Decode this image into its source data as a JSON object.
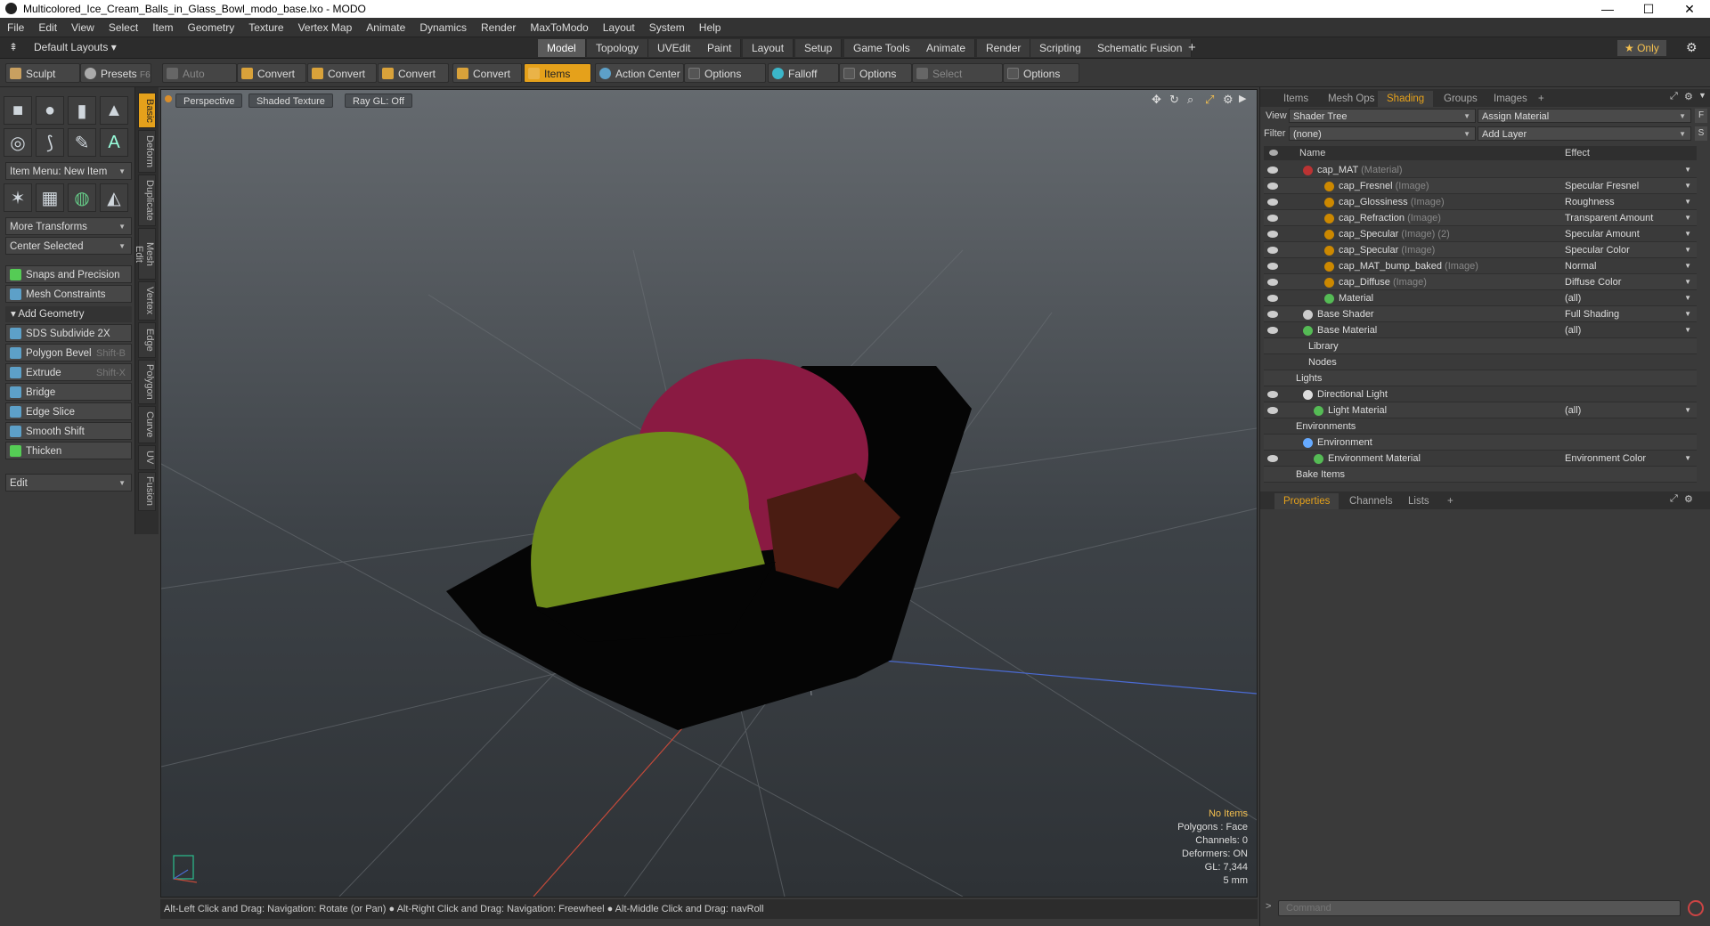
{
  "window": {
    "title": "Multicolored_Ice_Cream_Balls_in_Glass_Bowl_modo_base.lxo - MODO",
    "minimize": "—",
    "maximize": "☐",
    "close": "✕"
  },
  "menu": [
    "File",
    "Edit",
    "View",
    "Select",
    "Item",
    "Geometry",
    "Texture",
    "Vertex Map",
    "Animate",
    "Dynamics",
    "Render",
    "MaxToModo",
    "Layout",
    "System",
    "Help"
  ],
  "layout_bar": {
    "layouts": "Default Layouts ▾",
    "tabs": [
      "Model",
      "Topology",
      "UVEdit",
      "Paint",
      "Layout",
      "Setup",
      "Game Tools",
      "Animate",
      "Render",
      "Scripting",
      "Schematic Fusion"
    ],
    "active_tab": "Model",
    "add": "+",
    "only": "★ Only"
  },
  "toolbar": {
    "sculpt": "Sculpt",
    "presets": "Presets",
    "presets_key": "F6",
    "auto_select": "Auto Select",
    "convert1": "Convert",
    "convert2": "Convert",
    "convert3": "Convert",
    "convert4": "Convert",
    "items": "Items",
    "action_center": "Action Center",
    "options1": "Options",
    "falloff": "Falloff",
    "options2": "Options",
    "select_through": "Select Through",
    "options3": "Options"
  },
  "left_panel": {
    "item_menu": "Item Menu: New Item",
    "more_transforms": "More Transforms",
    "center_selected": "Center Selected",
    "snaps": "Snaps and Precision",
    "mesh_constraints": "Mesh Constraints",
    "add_geometry": "Add Geometry",
    "tools": [
      {
        "label": "SDS Subdivide 2X",
        "key": ""
      },
      {
        "label": "Polygon Bevel",
        "key": "Shift-B"
      },
      {
        "label": "Extrude",
        "key": "Shift-X"
      },
      {
        "label": "Bridge",
        "key": ""
      },
      {
        "label": "Edge Slice",
        "key": ""
      },
      {
        "label": "Smooth Shift",
        "key": ""
      },
      {
        "label": "Thicken",
        "key": ""
      }
    ],
    "edit": "Edit",
    "vtabs": [
      "Basic",
      "Deform",
      "Duplicate",
      "Mesh Edit",
      "Vertex",
      "Edge",
      "Polygon",
      "Curve",
      "UV",
      "Fusion"
    ]
  },
  "viewport": {
    "perspective": "Perspective",
    "shading": "Shaded Texture",
    "raygl": "Ray GL: Off",
    "info": {
      "no_items": "No Items",
      "polygons": "Polygons : Face",
      "channels": "Channels: 0",
      "deformers": "Deformers: ON",
      "gl": "GL: 7,344",
      "scale": "5 mm"
    }
  },
  "statusbar": "Alt-Left Click and Drag: Navigation: Rotate (or Pan) ● Alt-Right Click and Drag: Navigation: Freewheel ● Alt-Middle Click and Drag: navRoll",
  "right_panel": {
    "tabs": [
      "Items",
      "Mesh Ops",
      "Shading",
      "Groups",
      "Images",
      "+"
    ],
    "active_tab": "Shading",
    "view_label": "View",
    "view_value": "Shader Tree",
    "assign_material": "Assign Material",
    "f_btn": "F",
    "filter_label": "Filter",
    "filter_value": "(none)",
    "add_layer": "Add Layer",
    "s_btn": "S",
    "col_name": "Name",
    "col_effect": "Effect",
    "rows": [
      {
        "name": "cap_MAT",
        "type": "(Material)",
        "effect": "",
        "indent": 60,
        "dot": "#b33"
      },
      {
        "name": "cap_Fresnel",
        "type": "(Image)",
        "effect": "Specular Fresnel",
        "indent": 84,
        "dot": "#c80"
      },
      {
        "name": "cap_Glossiness",
        "type": "(Image)",
        "effect": "Roughness",
        "indent": 84,
        "dot": "#c80"
      },
      {
        "name": "cap_Refraction",
        "type": "(Image)",
        "effect": "Transparent Amount",
        "indent": 84,
        "dot": "#c80"
      },
      {
        "name": "cap_Specular",
        "type": "(Image) (2)",
        "effect": "Specular Amount",
        "indent": 84,
        "dot": "#c80"
      },
      {
        "name": "cap_Specular",
        "type": "(Image)",
        "effect": "Specular Color",
        "indent": 84,
        "dot": "#c80"
      },
      {
        "name": "cap_MAT_bump_baked",
        "type": "(Image)",
        "effect": "Normal",
        "indent": 84,
        "dot": "#c80"
      },
      {
        "name": "cap_Diffuse",
        "type": "(Image)",
        "effect": "Diffuse Color",
        "indent": 84,
        "dot": "#c80"
      },
      {
        "name": "Material",
        "type": "",
        "effect": "(all)",
        "indent": 84,
        "dot": "#5b5"
      },
      {
        "name": "Base Shader",
        "type": "",
        "effect": "Full Shading",
        "indent": 60,
        "dot": "#ccc"
      },
      {
        "name": "Base Material",
        "type": "",
        "effect": "(all)",
        "indent": 60,
        "dot": "#5b5"
      },
      {
        "name": "Library",
        "type": "",
        "effect": "",
        "indent": 50,
        "dot": ""
      },
      {
        "name": "Nodes",
        "type": "",
        "effect": "",
        "indent": 50,
        "dot": ""
      },
      {
        "name": "Lights",
        "type": "",
        "effect": "",
        "indent": 36,
        "dot": ""
      },
      {
        "name": "Directional Light",
        "type": "",
        "effect": "",
        "indent": 60,
        "dot": "#ddd"
      },
      {
        "name": "Light Material",
        "type": "",
        "effect": "(all)",
        "indent": 72,
        "dot": "#5b5"
      },
      {
        "name": "Environments",
        "type": "",
        "effect": "",
        "indent": 36,
        "dot": ""
      },
      {
        "name": "Environment",
        "type": "",
        "effect": "",
        "indent": 60,
        "dot": "#6af"
      },
      {
        "name": "Environment Material",
        "type": "",
        "effect": "Environment Color",
        "indent": 72,
        "dot": "#5b5"
      },
      {
        "name": "Bake Items",
        "type": "",
        "effect": "",
        "indent": 36,
        "dot": ""
      }
    ],
    "bottom_tabs": [
      "Properties",
      "Channels",
      "Lists",
      "+"
    ],
    "bottom_active": "Properties",
    "command_placeholder": "Command"
  }
}
